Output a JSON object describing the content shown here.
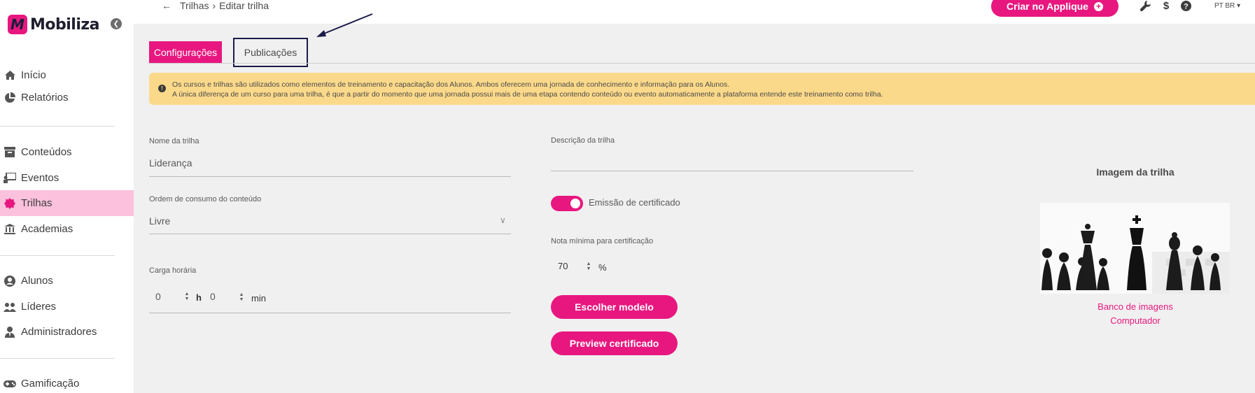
{
  "brand": {
    "name": "Mobiliza",
    "mark": "M",
    "accent": "#e8177f"
  },
  "sidebar": {
    "items": [
      {
        "label": "Início",
        "icon": "home-icon"
      },
      {
        "label": "Relatórios",
        "icon": "pie-chart-icon"
      },
      {
        "label": "Conteúdos",
        "icon": "archive-icon"
      },
      {
        "label": "Eventos",
        "icon": "presentation-icon"
      },
      {
        "label": "Trilhas",
        "icon": "badge-icon",
        "active": true
      },
      {
        "label": "Academias",
        "icon": "university-icon"
      },
      {
        "label": "Alunos",
        "icon": "user-circle-icon"
      },
      {
        "label": "Líderes",
        "icon": "users-icon"
      },
      {
        "label": "Administradores",
        "icon": "user-tie-icon"
      },
      {
        "label": "Gamificação",
        "icon": "gamepad-icon"
      }
    ]
  },
  "header": {
    "breadcrumb": {
      "parent": "Trilhas",
      "separator": ">",
      "current": "Editar trilha"
    },
    "create_button": "Criar no Applique",
    "language": "PT BR"
  },
  "tabs": [
    {
      "label": "Configurações",
      "active": true
    },
    {
      "label": "Publicações",
      "active": false
    }
  ],
  "alert": {
    "line1": "Os cursos e trilhas são utilizados como elementos de treinamento e capacitação dos Alunos. Ambos oferecem uma jornada de conhecimento e informação para os Alunos.",
    "line2": "A única diferença de um curso para uma trilha, é que a partir do momento que uma jornada possui mais de uma etapa contendo conteúdo ou evento automaticamente a plataforma entende este treinamento como trilha."
  },
  "form": {
    "name_label": "Nome da trilha",
    "name_value": "Liderança",
    "order_label": "Ordem de consumo do conteúdo",
    "order_value": "Livre",
    "workload_label": "Carga horária",
    "hours_value": "0",
    "hours_unit": "h",
    "minutes_value": "0",
    "minutes_unit": "min",
    "description_label": "Descrição da trilha",
    "description_value": "",
    "certificate_label": "Emissão de certificado",
    "certificate_enabled": true,
    "min_grade_label": "Nota mínima para certificação",
    "min_grade_value": "70",
    "min_grade_unit": "%",
    "choose_model_button": "Escolher modelo",
    "preview_button": "Preview certificado"
  },
  "image_panel": {
    "title": "Imagem da trilha",
    "bank_link": "Banco de imagens",
    "computer_link": "Computador"
  }
}
